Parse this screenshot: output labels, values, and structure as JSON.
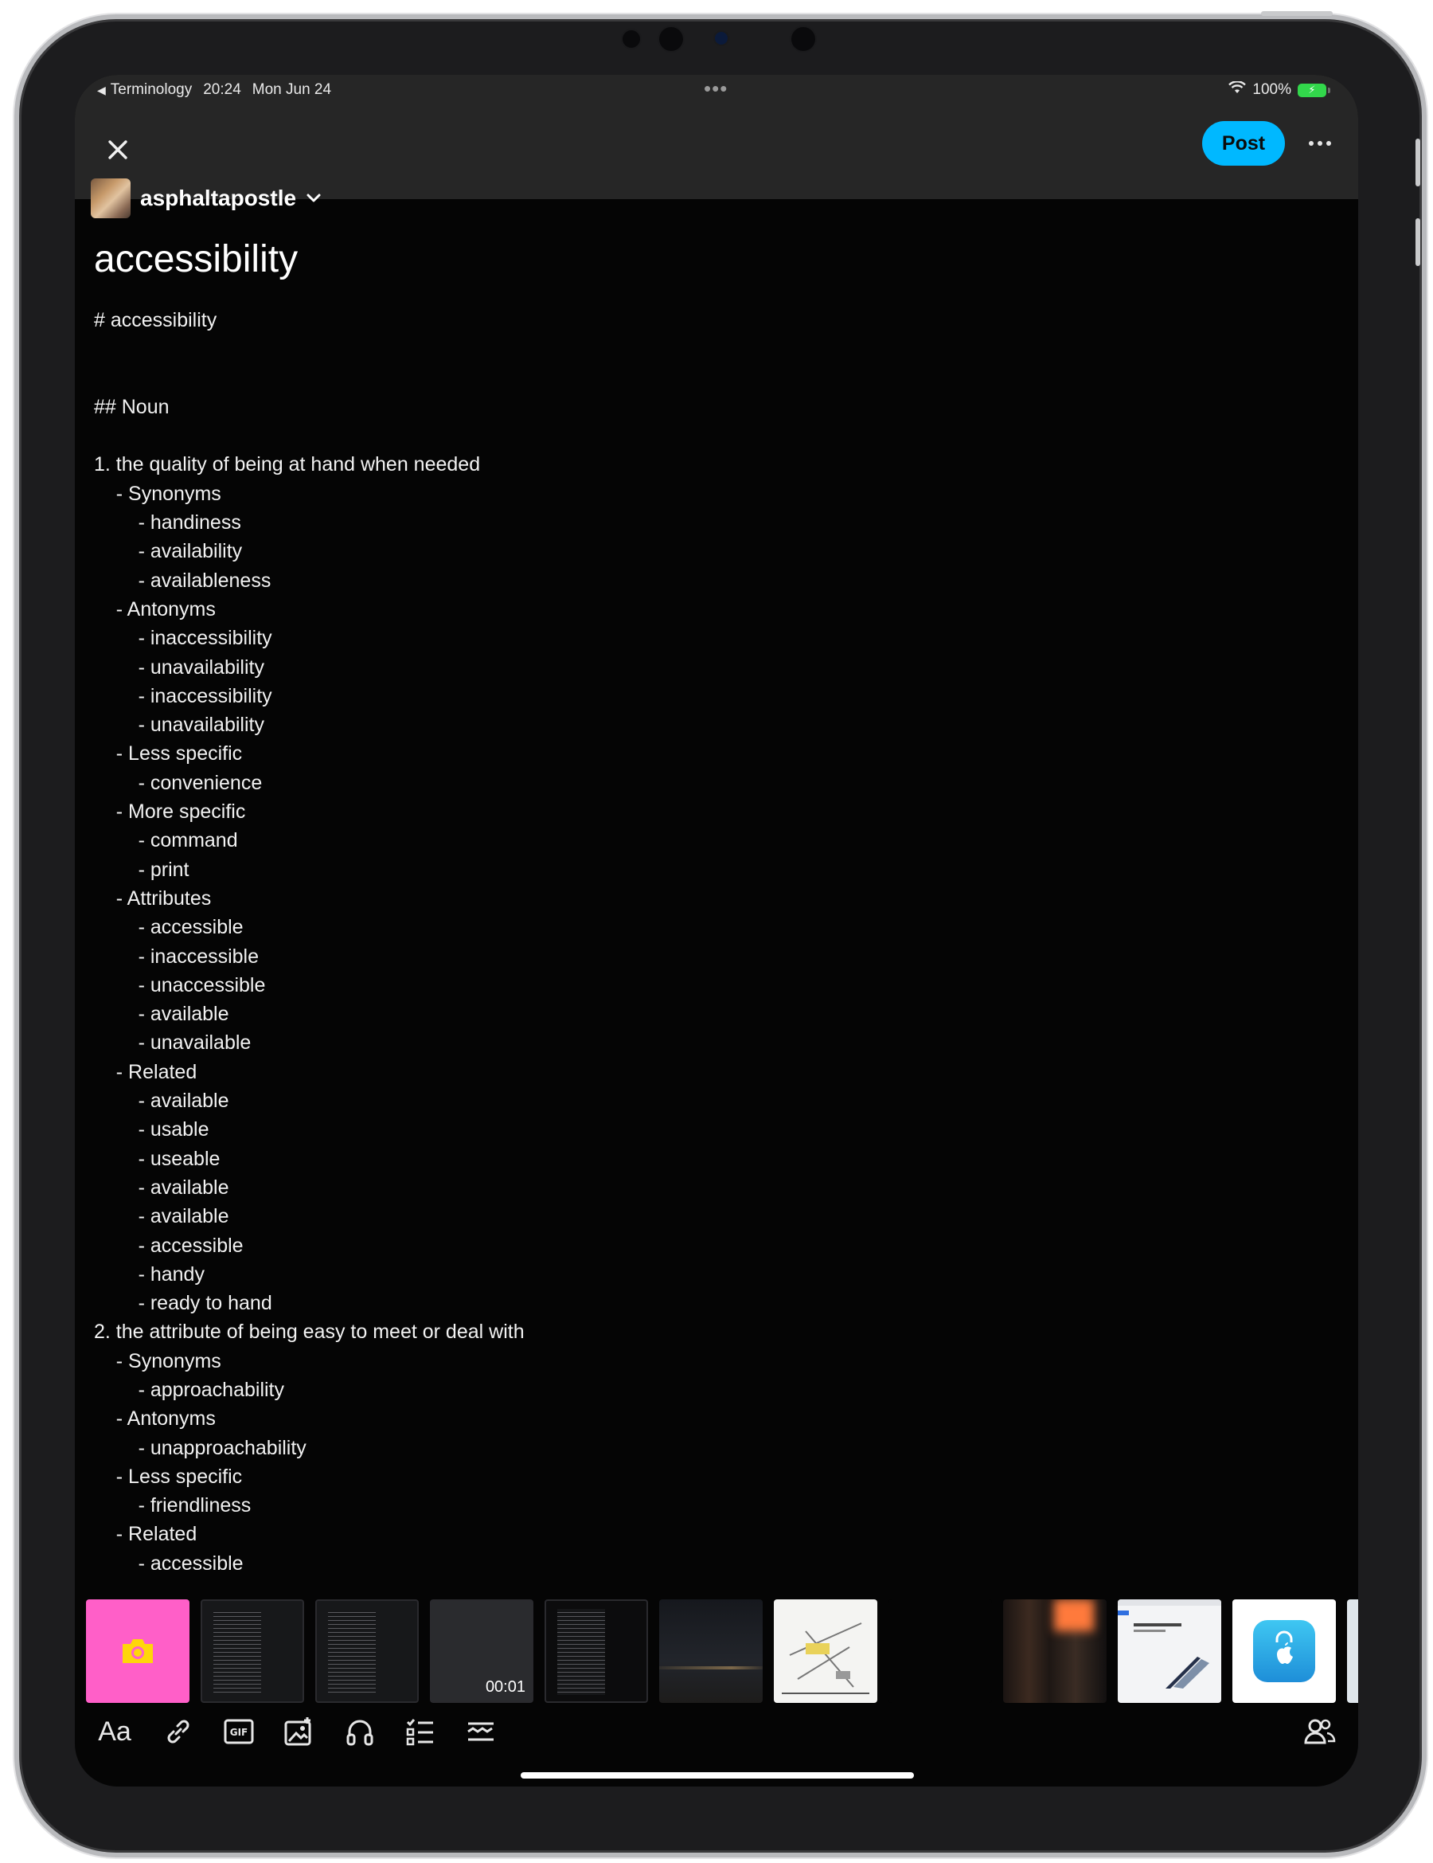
{
  "status_bar": {
    "back_app": "Terminology",
    "time": "20:24",
    "date": "Mon Jun 24",
    "battery": "100%"
  },
  "header": {
    "post_label": "Post"
  },
  "blog": {
    "name": "asphaltapostle"
  },
  "post": {
    "title": "accessibility",
    "lines": [
      "# accessibility",
      "",
      "",
      "## Noun",
      "",
      "1. the quality of being at hand when needed",
      "    - Synonyms",
      "        - handiness",
      "        - availability",
      "        - availableness",
      "    - Antonyms",
      "        - inaccessibility",
      "        - unavailability",
      "        - inaccessibility",
      "        - unavailability",
      "    - Less specific",
      "        - convenience",
      "    - More specific",
      "        - command",
      "        - print",
      "    - Attributes",
      "        - accessible",
      "        - inaccessible",
      "        - unaccessible",
      "        - available",
      "        - unavailable",
      "    - Related",
      "        - available",
      "        - usable",
      "        - useable",
      "        - available",
      "        - available",
      "        - accessible",
      "        - handy",
      "        - ready to hand",
      "2. the attribute of being easy to meet or deal with",
      "    - Synonyms",
      "        - approachability",
      "    - Antonyms",
      "        - unapproachability",
      "    - Less specific",
      "        - friendliness",
      "    - Related",
      "        - accessible"
    ]
  },
  "media_strip": {
    "video_duration": "00:01"
  },
  "toolbar": {
    "text_format_label": "Aa"
  },
  "colors": {
    "post_button": "#00b8ff",
    "camera_tile": "#ff5fc8",
    "background": "#050505",
    "bar": "#262626"
  }
}
